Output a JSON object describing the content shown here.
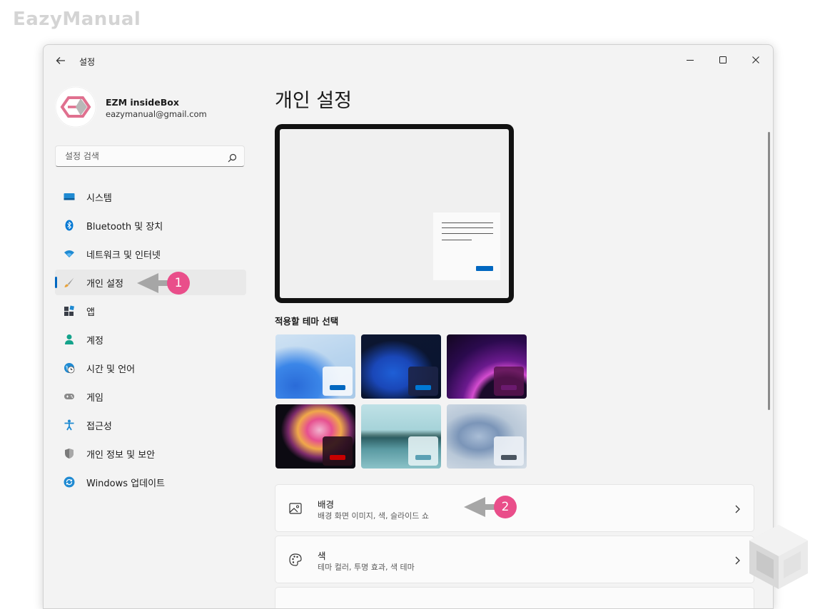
{
  "brand": "EazyManual",
  "window": {
    "title": "설정"
  },
  "profile": {
    "name": "EZM insideBox",
    "email": "eazymanual@gmail.com"
  },
  "search": {
    "placeholder": "설정 검색"
  },
  "sidebar": {
    "items": [
      {
        "label": "시스템",
        "icon": "monitor-icon"
      },
      {
        "label": "Bluetooth 및 장치",
        "icon": "bluetooth-icon"
      },
      {
        "label": "네트워크 및 인터넷",
        "icon": "wifi-icon"
      },
      {
        "label": "개인 설정",
        "icon": "paintbrush-icon",
        "selected": true
      },
      {
        "label": "앱",
        "icon": "apps-icon"
      },
      {
        "label": "계정",
        "icon": "person-icon"
      },
      {
        "label": "시간 및 언어",
        "icon": "globe-clock-icon"
      },
      {
        "label": "게임",
        "icon": "gamepad-icon"
      },
      {
        "label": "접근성",
        "icon": "accessibility-icon"
      },
      {
        "label": "개인 정보 및 보안",
        "icon": "shield-icon"
      },
      {
        "label": "Windows 업데이트",
        "icon": "update-icon"
      }
    ]
  },
  "main": {
    "title": "개인 설정",
    "theme_section_label": "적용할 테마 선택",
    "themes": [
      {
        "name": "windows-light-bloom",
        "accent": "#0067c0"
      },
      {
        "name": "windows-dark-bloom",
        "accent": "#0078d4"
      },
      {
        "name": "glow",
        "accent": "#6b1a6e"
      },
      {
        "name": "captured-motion",
        "accent": "#c80000"
      },
      {
        "name": "sunrise",
        "accent": "#5aa0b4"
      },
      {
        "name": "flow",
        "accent": "#4a5560"
      }
    ],
    "cards": [
      {
        "title": "배경",
        "subtitle": "배경 화면 이미지, 색, 슬라이드 쇼",
        "icon": "image-icon"
      },
      {
        "title": "색",
        "subtitle": "테마 컬러, 투명 효과, 색 테마",
        "icon": "palette-icon"
      }
    ]
  },
  "annotations": {
    "step1": "1",
    "step2": "2"
  },
  "colors": {
    "accent": "#0067c0",
    "callout": "#e94e8a",
    "arrow": "#a6a6a6"
  }
}
